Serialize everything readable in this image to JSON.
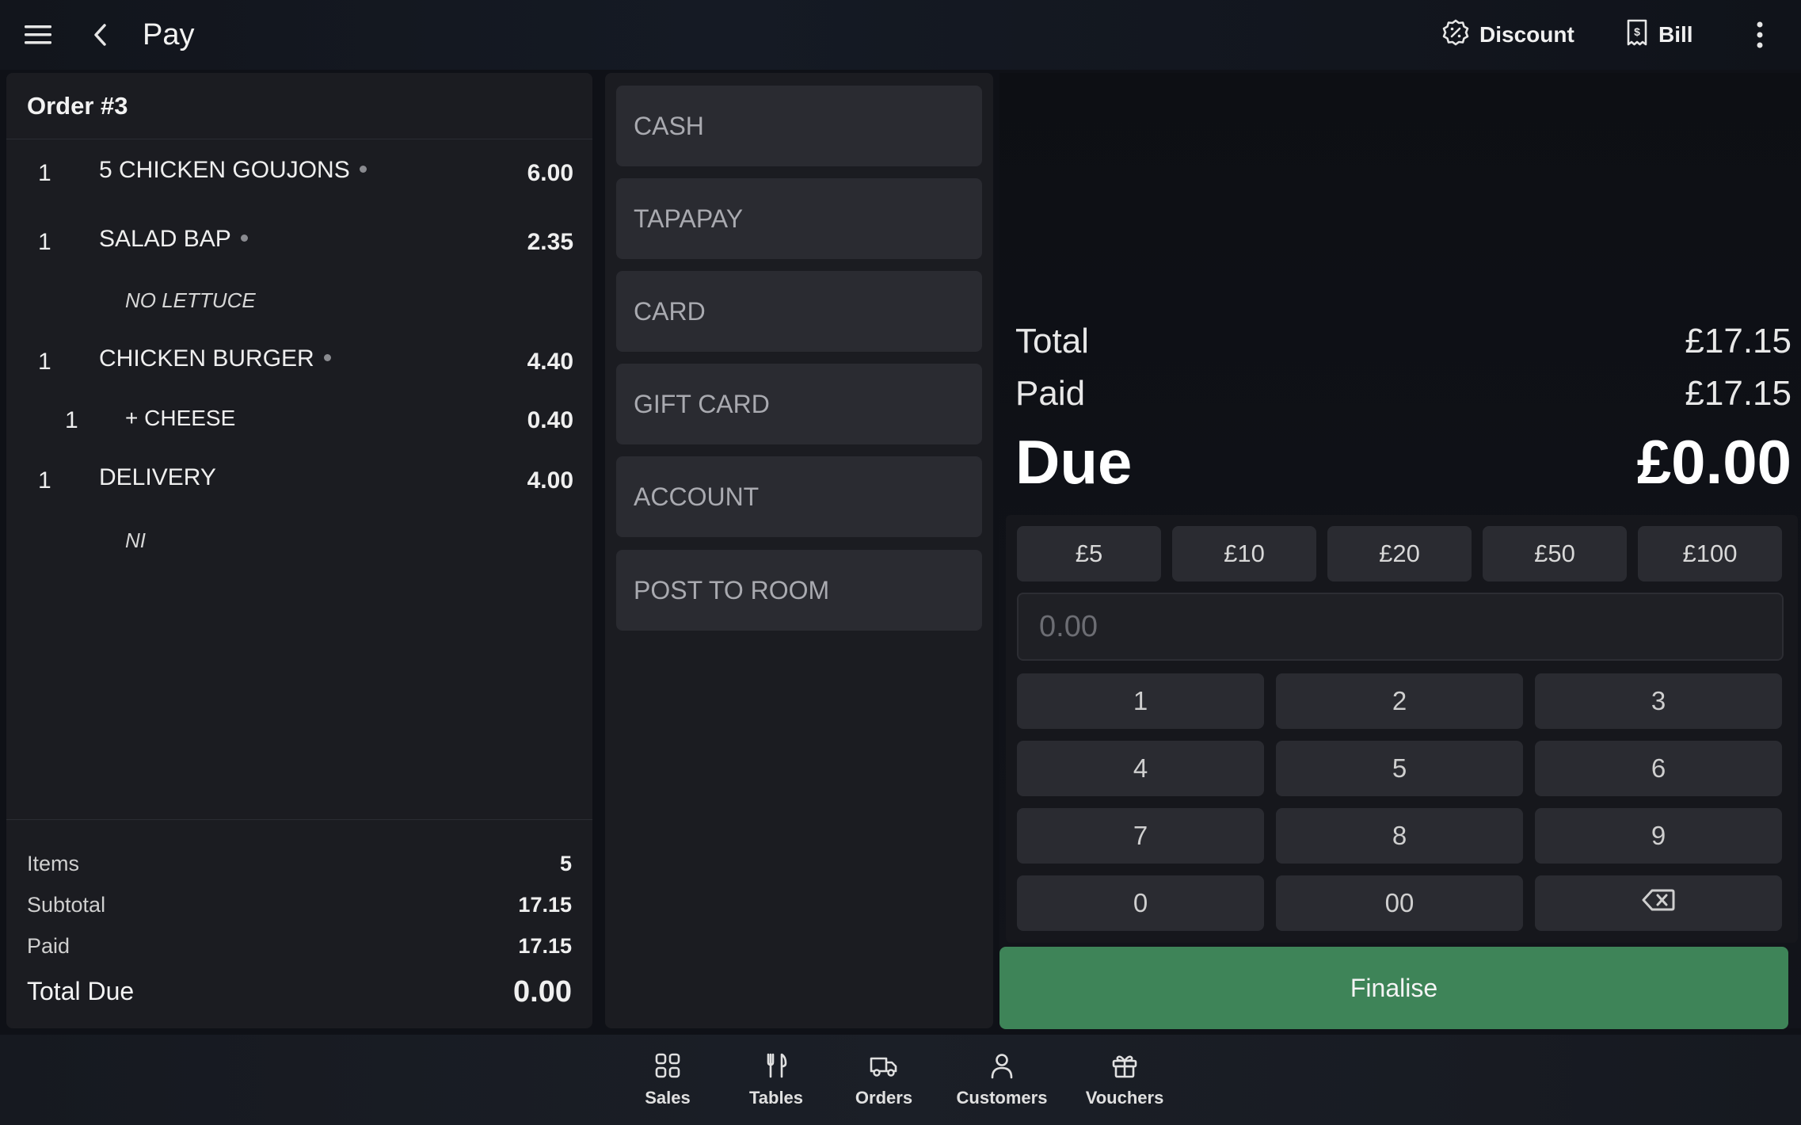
{
  "header": {
    "title": "Pay",
    "discount_label": "Discount",
    "bill_label": "Bill"
  },
  "order": {
    "title": "Order #3",
    "lines": [
      {
        "qty": "1",
        "name": "5 CHICKEN GOUJONS",
        "price": "6.00"
      },
      {
        "qty": "1",
        "name": "SALAD BAP",
        "price": "2.35",
        "note": "NO LETTUCE"
      },
      {
        "qty": "1",
        "name": "CHICKEN BURGER",
        "price": "4.40"
      },
      {
        "qty": "1",
        "name": "+ CHEESE",
        "price": "0.40"
      },
      {
        "qty": "1",
        "name": "DELIVERY",
        "price": "4.00",
        "note": "NI"
      }
    ],
    "summary": {
      "items_label": "Items",
      "items_value": "5",
      "subtotal_label": "Subtotal",
      "subtotal_value": "17.15",
      "paid_label": "Paid",
      "paid_value": "17.15",
      "total_due_label": "Total Due",
      "total_due_value": "0.00"
    }
  },
  "payment_methods": [
    "CASH",
    "TAPAPAY",
    "CARD",
    "GIFT CARD",
    "ACCOUNT",
    "POST TO ROOM"
  ],
  "totals": {
    "total_label": "Total",
    "total_value": "£17.15",
    "paid_label": "Paid",
    "paid_value": "£17.15",
    "due_label": "Due",
    "due_value": "£0.00"
  },
  "quick_amounts": [
    "£5",
    "£10",
    "£20",
    "£50",
    "£100"
  ],
  "amount_input": {
    "placeholder": "0.00",
    "value": ""
  },
  "keypad": [
    "1",
    "2",
    "3",
    "4",
    "5",
    "6",
    "7",
    "8",
    "9",
    "0",
    "00"
  ],
  "finalise_label": "Finalise",
  "nav": [
    {
      "label": "Sales",
      "icon": "grid-icon"
    },
    {
      "label": "Tables",
      "icon": "cutlery-icon"
    },
    {
      "label": "Orders",
      "icon": "delivery-truck-icon"
    },
    {
      "label": "Customers",
      "icon": "person-icon"
    },
    {
      "label": "Vouchers",
      "icon": "gift-icon"
    }
  ],
  "colors": {
    "background": "#0f1117",
    "panel": "#1b1c21",
    "button": "#2a2b31",
    "finalise": "#3e8458"
  }
}
